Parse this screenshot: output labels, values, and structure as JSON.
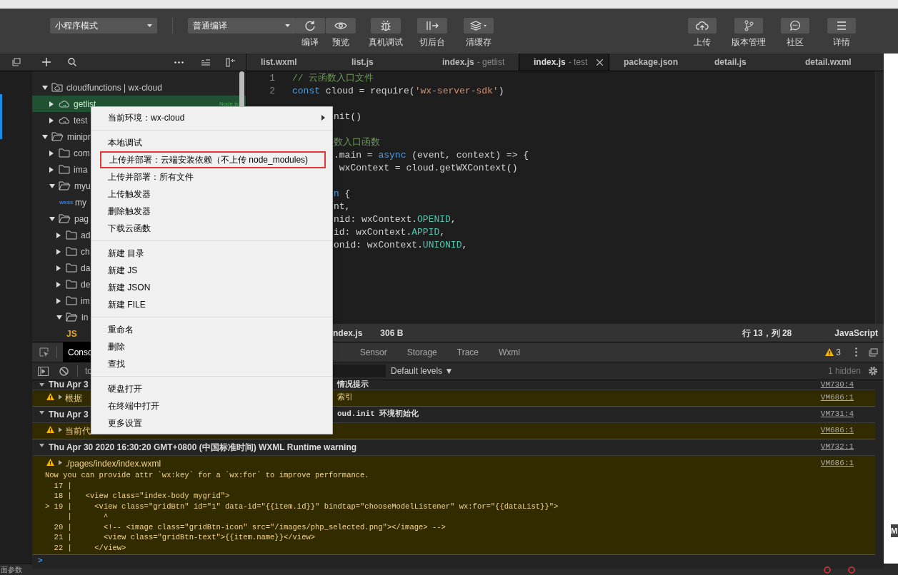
{
  "toolbar": {
    "mode_dropdown": "小程序模式",
    "compile_dropdown": "普通编译",
    "tools": [
      {
        "kind": "refresh",
        "label": "编译"
      },
      {
        "kind": "eye",
        "label": "预览"
      },
      {
        "kind": "bug",
        "label": "真机调试"
      },
      {
        "kind": "switch",
        "label": "切后台"
      },
      {
        "kind": "layers",
        "label": "清缓存"
      }
    ],
    "right_tools": [
      {
        "kind": "upload",
        "label": "上传"
      },
      {
        "kind": "branch",
        "label": "版本管理"
      },
      {
        "kind": "chat",
        "label": "社区"
      },
      {
        "kind": "menu",
        "label": "详情"
      }
    ]
  },
  "file_tree": [
    {
      "kind": "cloud-root",
      "label": "cloudfunctions | wx-cloud",
      "expanded": true,
      "selected": false,
      "children": [
        {
          "kind": "cloud-function",
          "label": "getlist",
          "expanded": false,
          "selected": true,
          "tag": "Node.js"
        },
        {
          "kind": "cloud-function",
          "label": "test",
          "expanded": false,
          "selected": false
        }
      ]
    },
    {
      "kind": "folder",
      "label": "minipr",
      "expanded": true,
      "selected": false,
      "children": [
        {
          "kind": "folder",
          "label": "com",
          "expanded": false,
          "selected": false
        },
        {
          "kind": "folder",
          "label": "ima",
          "expanded": false,
          "selected": false
        },
        {
          "kind": "folder",
          "label": "myu",
          "expanded": true,
          "selected": false,
          "children": [
            {
              "kind": "file",
              "badge": "wxss",
              "label": "my",
              "selected": false
            }
          ]
        },
        {
          "kind": "folder",
          "label": "pag",
          "expanded": true,
          "selected": false,
          "children": [
            {
              "kind": "folder",
              "label": "ad",
              "expanded": false,
              "selected": false
            },
            {
              "kind": "folder",
              "label": "ch",
              "expanded": false,
              "selected": false
            },
            {
              "kind": "folder",
              "label": "da",
              "expanded": false,
              "selected": false
            },
            {
              "kind": "folder",
              "label": "de",
              "expanded": false,
              "selected": false
            },
            {
              "kind": "folder",
              "label": "im",
              "expanded": false,
              "selected": false
            },
            {
              "kind": "folder",
              "label": "in",
              "expanded": true,
              "selected": false,
              "children": [
                {
                  "kind": "file",
                  "badge": "JS",
                  "selected": false
                }
              ]
            }
          ]
        }
      ]
    }
  ],
  "editor": {
    "tabs": [
      {
        "label": "list.wxml",
        "selected": false
      },
      {
        "label": "list.js",
        "selected": false
      },
      {
        "label": "index.js",
        "detail": "- getlist",
        "selected": false
      },
      {
        "label": "index.js",
        "detail": "- test",
        "selected": true
      },
      {
        "label": "package.json",
        "selected": false
      },
      {
        "label": "detail.js",
        "selected": false
      },
      {
        "label": "detail.wxml",
        "selected": false
      }
    ],
    "lines": [
      {
        "kind": "full",
        "number": "1",
        "tokens": [
          {
            "kind": "comment",
            "text": "// 云函数入口文件"
          }
        ]
      },
      {
        "kind": "full",
        "number": "2",
        "tokens": [
          {
            "kind": "keyword",
            "text": "const"
          },
          {
            "kind": "plain",
            "text": " cloud = require("
          },
          {
            "kind": "string",
            "text": "'wx-server-sdk'"
          },
          {
            "kind": "plain",
            "text": ")"
          }
        ]
      },
      {
        "kind": "blank"
      },
      {
        "kind": "clipped",
        "tokens": [
          {
            "kind": "plain",
            "text": "nit()"
          }
        ]
      },
      {
        "kind": "blank"
      },
      {
        "kind": "clipped",
        "tokens": [
          {
            "kind": "comment",
            "text": "数入口函数"
          }
        ]
      },
      {
        "kind": "clipped",
        "tokens": [
          {
            "kind": "plain",
            "text": ".main = "
          },
          {
            "kind": "keyword",
            "text": "async"
          },
          {
            "kind": "plain",
            "text": " (event, context) => {"
          }
        ]
      },
      {
        "kind": "clipped",
        "tokens": [
          {
            "kind": "plain",
            "text": " wxContext = cloud.getWXContext()"
          }
        ]
      },
      {
        "kind": "blank"
      },
      {
        "kind": "clipped",
        "tokens": [
          {
            "kind": "keyword",
            "text": "n"
          },
          {
            "kind": "plain",
            "text": " {"
          }
        ]
      },
      {
        "kind": "clipped",
        "tokens": [
          {
            "kind": "plain",
            "text": "nt,"
          }
        ]
      },
      {
        "kind": "clipped",
        "tokens": [
          {
            "kind": "plain",
            "text": "nid: wxContext."
          },
          {
            "kind": "property",
            "text": "OPENID"
          },
          {
            "kind": "plain",
            "text": ","
          }
        ]
      },
      {
        "kind": "clipped",
        "tokens": [
          {
            "kind": "plain",
            "text": "id: wxContext."
          },
          {
            "kind": "property",
            "text": "APPID"
          },
          {
            "kind": "plain",
            "text": ","
          }
        ]
      },
      {
        "kind": "clipped",
        "tokens": [
          {
            "kind": "plain",
            "text": "onid: wxContext."
          },
          {
            "kind": "property",
            "text": "UNIONID"
          },
          {
            "kind": "plain",
            "text": ","
          }
        ]
      }
    ],
    "status": {
      "file": "ndex.js",
      "size": "306 B",
      "position": "行 13，列 28",
      "language": "JavaScript"
    }
  },
  "console": {
    "tabs": [
      {
        "label": "Conso",
        "selected": true
      },
      {
        "label": "Sensor",
        "selected": false
      },
      {
        "label": "Storage",
        "selected": false
      },
      {
        "label": "Trace",
        "selected": false
      },
      {
        "label": "Wxml",
        "selected": false
      }
    ],
    "warning_count": "3",
    "filter": "to",
    "levels": "Default levels ▼",
    "hidden": "1 hidden",
    "logs": [
      {
        "kind": "header",
        "text": "Thu Apr 3",
        "text_after": "情况提示",
        "source": "VM730:4"
      },
      {
        "kind": "warning",
        "text": "根据",
        "text_after": "索引",
        "source": "VM686:1"
      },
      {
        "kind": "header",
        "text": "Thu Apr 3",
        "text_after": "oud.init 环境初始化",
        "source": "VM731:4"
      },
      {
        "kind": "warning",
        "text": "当前代",
        "source": "VM686:1"
      },
      {
        "kind": "header",
        "text": "Thu Apr 30 2020 16:30:20 GMT+0800 (中国标准时间) WXML Runtime warning",
        "source": "VM732:1"
      },
      {
        "kind": "warning",
        "text": "./pages/index/index.wxml",
        "source": "VM686:1",
        "lines": [
          "Now you can provide attr `wx:key` for a `wx:for` to improve performance.",
          "  17 |",
          "  18 |   <view class=\"index-body mygrid\">",
          "> 19 |     <view class=\"gridBtn\" id=\"1\" data-id=\"{{item.id}}\" bindtap=\"chooseModelListener\" wx:for=\"{{dataList}}\">",
          "     |       ^",
          "  20 |       <!-- <image class=\"gridBtn-icon\" src=\"/images/php_selected.png\"></image> -->",
          "  21 |       <view class=\"gridBtn-text\">{{item.name}}</view>",
          "  22 |     </view>"
        ]
      }
    ],
    "prompt": ">"
  },
  "context_menu": {
    "groups": [
      [
        {
          "label": "当前环境：wx-cloud",
          "submenu": true,
          "outlined": false
        }
      ],
      [
        {
          "label": "本地调试",
          "submenu": false,
          "outlined": false
        },
        {
          "label": "上传并部署：云端安装依赖（不上传 node_modules)",
          "submenu": false,
          "outlined": true
        },
        {
          "label": "上传并部署：所有文件",
          "submenu": false,
          "outlined": false
        },
        {
          "label": "上传触发器",
          "submenu": false,
          "outlined": false
        },
        {
          "label": "删除触发器",
          "submenu": false,
          "outlined": false
        },
        {
          "label": "下载云函数",
          "submenu": false,
          "outlined": false
        }
      ],
      [
        {
          "label": "新建 目录",
          "submenu": false,
          "outlined": false
        },
        {
          "label": "新建 JS",
          "submenu": false,
          "outlined": false
        },
        {
          "label": "新建 JSON",
          "submenu": false,
          "outlined": false
        },
        {
          "label": "新建 FILE",
          "submenu": false,
          "outlined": false
        }
      ],
      [
        {
          "label": "重命名",
          "submenu": false,
          "outlined": false
        },
        {
          "label": "删除",
          "submenu": false,
          "outlined": false
        },
        {
          "label": "查找",
          "submenu": false,
          "outlined": false
        }
      ],
      [
        {
          "label": "硬盘打开",
          "submenu": false,
          "outlined": false
        },
        {
          "label": "在终端中打开",
          "submenu": false,
          "outlined": false
        },
        {
          "label": "更多设置",
          "submenu": false,
          "outlined": false
        }
      ]
    ]
  },
  "bottom_bar": {
    "text": "面参数"
  },
  "side_label": "M"
}
